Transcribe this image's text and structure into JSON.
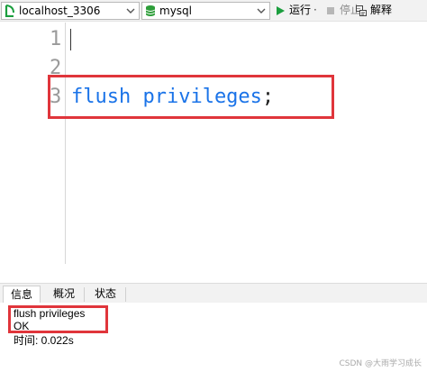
{
  "toolbar": {
    "connection": {
      "value": "localhost_3306",
      "icon": "connection-icon"
    },
    "database": {
      "value": "mysql",
      "icon": "database-icon"
    },
    "run_label": "运行",
    "run_dropdown": "·",
    "stop_label": "停止",
    "explain_label": "解释"
  },
  "editor": {
    "line_numbers": [
      "1",
      "2",
      "3"
    ],
    "code_keyword": "flush privileges",
    "code_terminator": ";"
  },
  "panel": {
    "tabs": [
      "信息",
      "概况",
      "状态"
    ],
    "output": [
      "flush privileges",
      "OK",
      "时间: 0.022s"
    ]
  },
  "watermark": "CSDN @大雨学习成长",
  "colors": {
    "keyword": "#1a73e8",
    "highlight_box": "#e0353b",
    "run_green": "#1b9e3e",
    "db_green": "#2e9e3a"
  }
}
